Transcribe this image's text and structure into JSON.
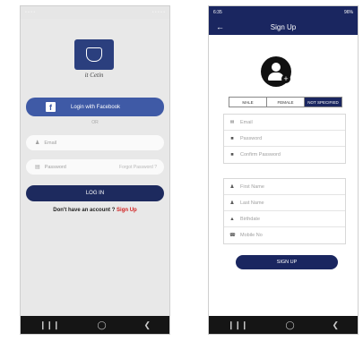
{
  "left": {
    "logo": {
      "caption": "it Cetin"
    },
    "facebook_button": "Login with Facebook",
    "or_text": "OR",
    "email_placeholder": "Email",
    "password_placeholder": "Password",
    "forgot_password": "Forgot Password ?",
    "login_button": "LOG IN",
    "no_account_text": "Don't have an account ?",
    "signup_link": "Sign Up"
  },
  "right": {
    "status": {
      "time": "6:35",
      "battery": "96%"
    },
    "header_title": "Sign Up",
    "gender_options": [
      "MALE",
      "FEMALE",
      "NOT SPECIFIED"
    ],
    "credentials": {
      "email": "Email",
      "password": "Password",
      "confirm_password": "Confirm Password"
    },
    "profile": {
      "first_name": "First Name",
      "last_name": "Last Name",
      "birthdate": "Birthdate",
      "mobile": "Mobile No"
    },
    "signup_button": "SIGN UP"
  },
  "colors": {
    "navy": "#1a2660",
    "facebook": "#3f5aa6",
    "link_red": "#d02020"
  }
}
